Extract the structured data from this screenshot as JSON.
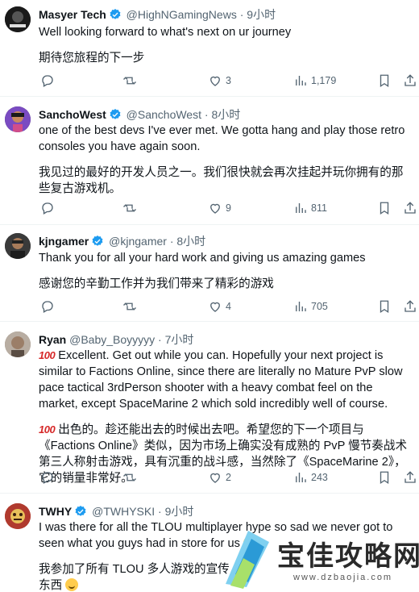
{
  "tweets": [
    {
      "name": "Masyer Tech",
      "handle": "@HighNGamingNews",
      "time": "9小时",
      "text": "Well looking forward to what's next on ur journey",
      "translation": "期待您旅程的下一步",
      "likes": "3",
      "views": "1,179",
      "verified": true
    },
    {
      "name": "SanchoWest",
      "handle": "@SanchoWest",
      "time": "8小时",
      "text": "one of the best devs I've ever met. We gotta hang and play those retro consoles you have again soon.",
      "translation": "我见过的最好的开发人员之一。我们很快就会再次挂起并玩你拥有的那些复古游戏机。",
      "likes": "9",
      "views": "811",
      "verified": true
    },
    {
      "name": "kjngamer",
      "handle": "@kjngamer",
      "time": "8小时",
      "text": "Thank you for all your hard work and giving us amazing games",
      "translation": "感谢您的辛勤工作并为我们带来了精彩的游戏",
      "likes": "4",
      "views": "705",
      "verified": true
    },
    {
      "name": "Ryan",
      "handle": "@Baby_Boyyyyy",
      "time": "7小时",
      "emoji": "100",
      "text": "Excellent. Get out while you can. Hopefully your next project is similar to Factions Online, since there are literally no Mature PvP slow pace tactical 3rdPerson shooter with a heavy combat feel on the market, except SpaceMarine 2 which sold incredibly well of course.",
      "translation": "出色的。趁还能出去的时候出去吧。希望您的下一个项目与《Factions Online》类似，因为市场上确实没有成熟的 PvP 慢节奏战术第三人称射击游戏，具有沉重的战斗感，当然除了《SpaceMarine 2》，它的销量非常好。",
      "likes": "2",
      "views": "243",
      "verified": false
    },
    {
      "name": "TWHY",
      "handle": "@TWHYSKI",
      "time": "9小时",
      "text": "I was there for all the TLOU multiplayer hype so sad we never got to seen what you guys had in store for us",
      "translation_line1": "我参加了所有 TLOU 多人游戏的宣传，",
      "translation_line2": "东西",
      "verified": true
    }
  ],
  "watermark": {
    "title": "宝佳攻略网",
    "url": "www.dzbaojia.com"
  },
  "colors": {
    "verified": "#1d9bf0",
    "secondary_text": "#536471",
    "divider": "#eff3f4"
  },
  "icons": [
    "reply-icon",
    "retweet-icon",
    "like-icon",
    "views-icon",
    "bookmark-icon",
    "share-icon",
    "verified-badge-icon"
  ]
}
